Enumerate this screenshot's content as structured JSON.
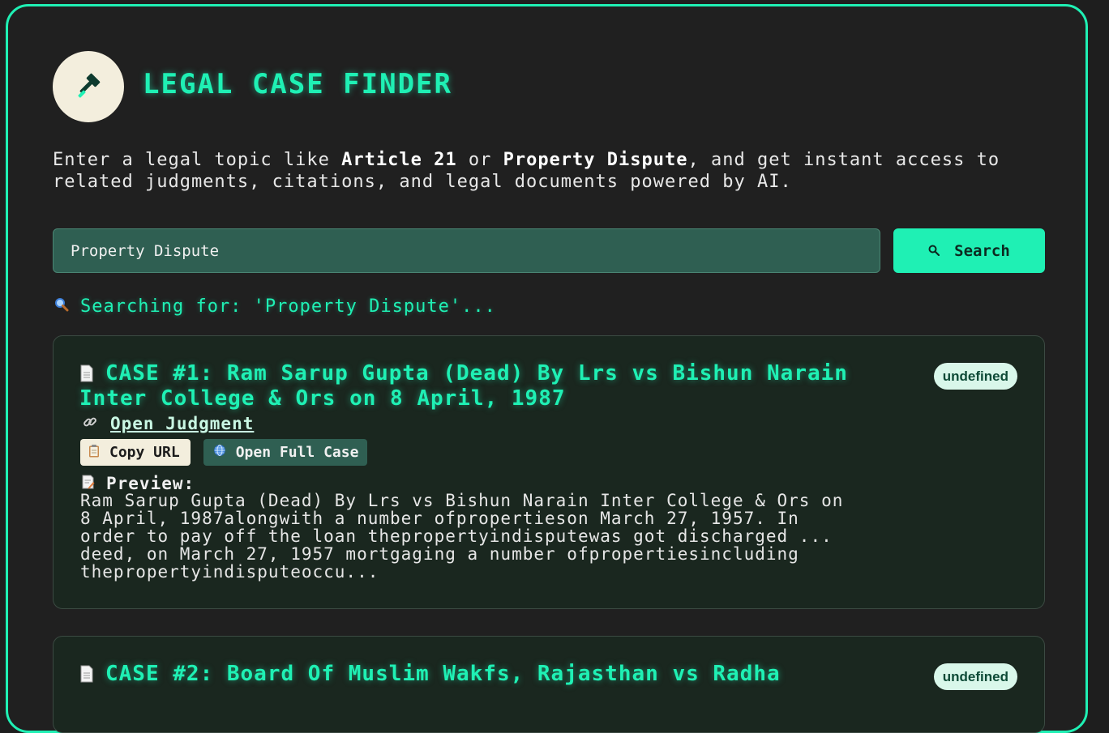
{
  "app": {
    "title": "LEGAL CASE FINDER",
    "icon": "gavel-icon"
  },
  "intro": {
    "part1": "Enter a legal topic like ",
    "example1": "Article 21",
    "part2": " or ",
    "example2": "Property Dispute",
    "part3": ", and get instant access to related judgments, citations, and legal documents powered by AI."
  },
  "search": {
    "value": "Property Dispute",
    "button_label": "Search",
    "status": "Searching for: 'Property Dispute'..."
  },
  "cases": [
    {
      "title": "CASE #1: Ram Sarup Gupta (Dead) By Lrs vs Bishun Narain Inter College & Ors on 8 April, 1987",
      "badge": "undefined",
      "open_judgment_label": "Open Judgment",
      "copy_url_label": "Copy URL",
      "open_full_case_label": "Open Full Case",
      "preview_label": "Preview:",
      "preview_text": "Ram Sarup Gupta (Dead) By Lrs vs Bishun Narain Inter College & Ors on\n8 April, 1987alongwith a number ofpropertieson March 27, 1957. In\norder to pay off the loan thepropertyindisputewas got discharged ...\ndeed, on March 27, 1957 mortgaging a number ofpropertiesincluding\nthepropertyindisputeoccu..."
    },
    {
      "title": "CASE #2: Board Of Muslim Wakfs, Rajasthan vs Radha",
      "badge": "undefined"
    }
  ],
  "colors": {
    "accent": "#1ff0b4",
    "background": "#202020",
    "card": "#1a271f",
    "input": "#2f5f52",
    "logo_bg": "#f3eedd"
  }
}
